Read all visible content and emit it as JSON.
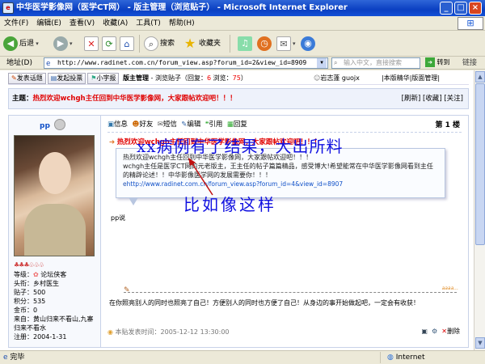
{
  "window": {
    "title": "中华医学影像网（医学CT网） - 版主管理（浏览贴子） - Microsoft Internet Explorer",
    "min_glyph": "_",
    "max_glyph": "□",
    "close_glyph": "×"
  },
  "menu": [
    "文件(F)",
    "编辑(E)",
    "查看(V)",
    "收藏(A)",
    "工具(T)",
    "帮助(H)"
  ],
  "toolbar": {
    "back": "后退",
    "search": "搜索",
    "favorites": "收藏夹"
  },
  "address": {
    "label": "地址(D)",
    "url": "http://www.radinet.com.cn/forum_view.asp?forum_id=2&view_id=8909",
    "search_placeholder": "输入中文，直接搜索",
    "go": "转到",
    "links": "链接"
  },
  "forum_nav": {
    "buttons": [
      "发表话题",
      "发起投票",
      "小字报"
    ],
    "crumb_prefix": "版主管理",
    "crumb_sep": " - 浏览贴子（回复：",
    "replies": "6",
    "views_label": " 浏览：",
    "views": "75",
    "views_end": "）",
    "moderator": "岩志蓬 guojx",
    "links": [
      "本版精华",
      "版面管理"
    ]
  },
  "topic": {
    "label": "主题：",
    "title": "热烈欢迎wchgh主任回到中华医学影像网，大家跟帖欢迎吧！！！",
    "actions": [
      "刷新",
      "收藏",
      "关注"
    ]
  },
  "user": {
    "name": "pp",
    "level_label": "等级：",
    "level": "论坛侠客",
    "rank_label": "头衔：",
    "rank": "乡村医生",
    "posts_label": "贴子：",
    "posts": "500",
    "points_label": "积分：",
    "points": "535",
    "gold_label": "金币：",
    "gold": "0",
    "from_label": "来自：",
    "from": "黄山归来不看山,九寨归来不看水",
    "joined_label": "注册：",
    "joined": "2004-1-31"
  },
  "post_actions": [
    "信息",
    "好友",
    "短信",
    "编辑",
    "引用",
    "回复"
  ],
  "post": {
    "floor": "第 1 楼",
    "quote_title": "热烈欢迎wchgh主任回到中华医学影像网，大家跟帖欢迎吧！！！",
    "quote_body_1": "热烈欢迎wchgh主任回到中华医学影像网，大家跟帖欢迎吧！！！",
    "quote_body_2": "wchgh主任是医学CT网的元老版主，王主任的帖子篇篇精品，感受博大!希望能常在中华医学影像网看到主任的精辟论述！！中华影像医学网的发展需要你！！！",
    "quote_link": "http://www.radinet.com.cn/forum_view.asp?forum_id=4&view_id=8907",
    "quoted_by": "pp说",
    "overlay_1": "xx病例有了结果，大出所料",
    "overlay_2": "比如像这样",
    "watermark": "aaaa...",
    "signature": "在你照亮别人的同时也照亮了自己！方便别人的同时也方便了自己！从身边的事开始做起吧，一定会有收获！",
    "time_label": "本贴发表时间：",
    "time": "2005-12-12 13:30:00",
    "delete": "删除"
  },
  "status": {
    "left": "完毕",
    "zone": "Internet"
  },
  "colors": {
    "title_blue": "#0a3fc2",
    "forum_red": "#e00000",
    "link_blue": "#1050c8"
  }
}
